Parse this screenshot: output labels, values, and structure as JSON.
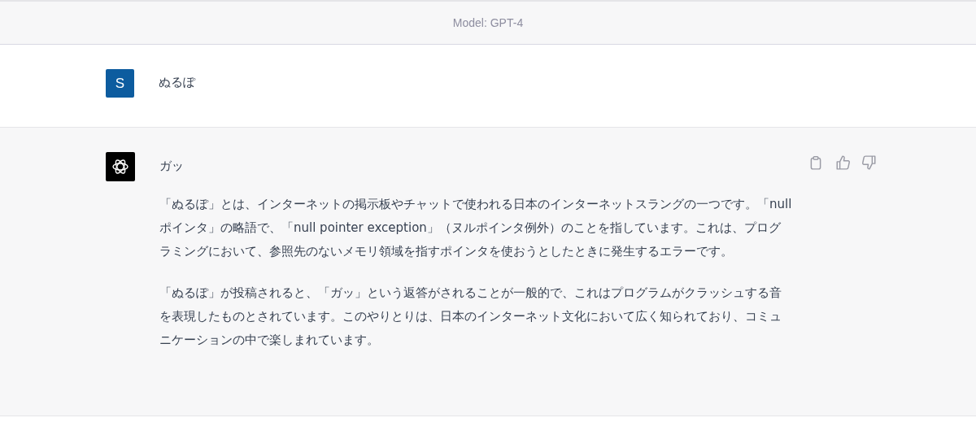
{
  "header": {
    "model_label": "Model: GPT-4"
  },
  "messages": [
    {
      "kind": "user",
      "avatar_letter": "S",
      "paragraphs": [
        "ぬるぽ"
      ]
    },
    {
      "kind": "assistant",
      "paragraphs": [
        "ガッ",
        "「ぬるぽ」とは、インターネットの掲示板やチャットで使われる日本のインターネットスラングの一つです。「null ポインタ」の略語で、「null pointer exception」（ヌルポインタ例外）のことを指しています。これは、プログラミングにおいて、参照先のないメモリ領域を指すポインタを使おうとしたときに発生するエラーです。",
        "「ぬるぽ」が投稿されると、「ガッ」という返答がされることが一般的で、これはプログラムがクラッシュする音を表現したものとされています。このやりとりは、日本のインターネット文化において広く知られており、コミュニケーションの中で楽しまれています。"
      ]
    }
  ]
}
